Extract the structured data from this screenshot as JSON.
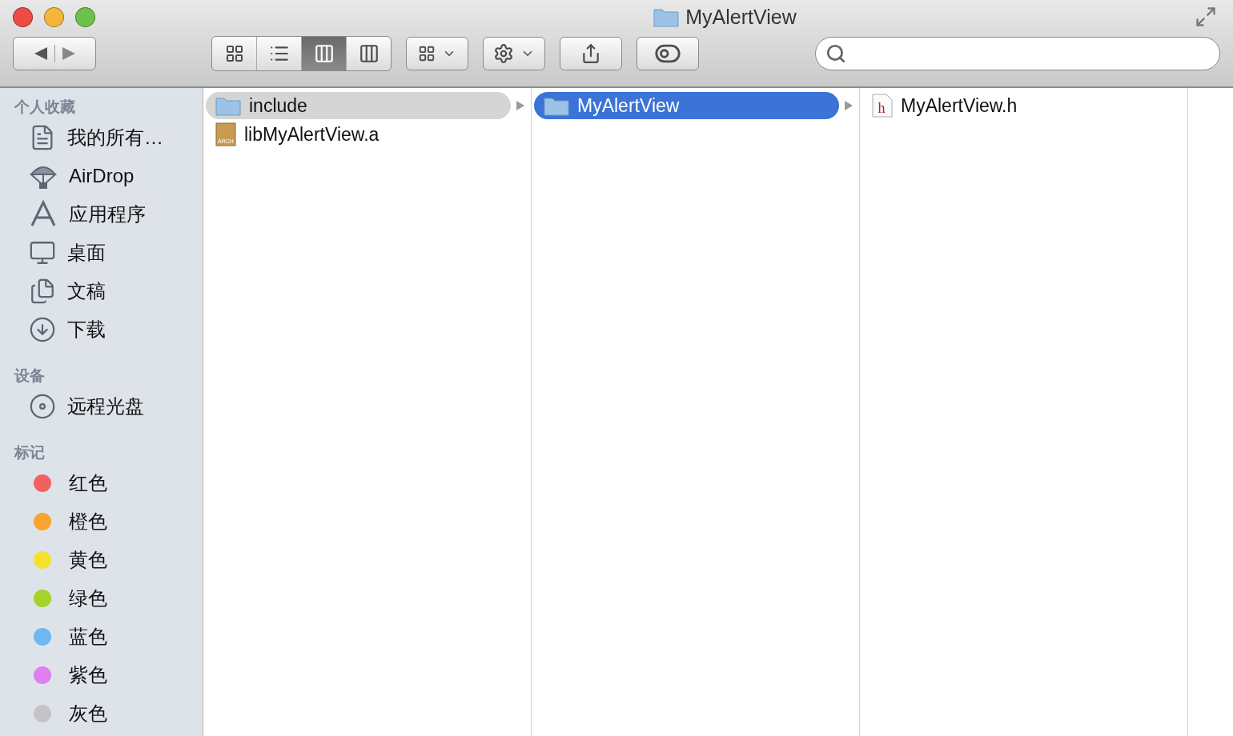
{
  "window": {
    "title": "MyAlertView"
  },
  "toolbar": {
    "view_modes": [
      {
        "kind": "icons",
        "selected": false
      },
      {
        "kind": "list",
        "selected": false
      },
      {
        "kind": "columns",
        "selected": true
      },
      {
        "kind": "coverflow",
        "selected": false
      }
    ]
  },
  "sidebar": {
    "sections": [
      {
        "kind": "places",
        "title": "个人收藏",
        "items": [
          {
            "label": "我的所有…"
          },
          {
            "label": "AirDrop"
          },
          {
            "label": "应用程序"
          },
          {
            "label": "桌面"
          },
          {
            "label": "文稿"
          },
          {
            "label": "下载"
          }
        ]
      },
      {
        "kind": "devices",
        "title": "设备",
        "items": [
          {
            "label": "远程光盘"
          }
        ]
      },
      {
        "kind": "tags",
        "title": "标记",
        "items": [
          {
            "label": "红色",
            "color": "#f0625e"
          },
          {
            "label": "橙色",
            "color": "#f9a42c"
          },
          {
            "label": "黄色",
            "color": "#f3e12e"
          },
          {
            "label": "绿色",
            "color": "#a5d32b"
          },
          {
            "label": "蓝色",
            "color": "#6fb8f2"
          },
          {
            "label": "紫色",
            "color": "#e07ff0"
          },
          {
            "label": "灰色",
            "color": "#c4c4c4"
          }
        ]
      }
    ]
  },
  "columns": [
    {
      "items": [
        {
          "name": "include",
          "kind": "folder",
          "selected": true,
          "focused": false,
          "has_children": true
        },
        {
          "name": "libMyAlertView.a",
          "kind": "archive",
          "icon_label": "ARCH",
          "selected": false,
          "has_children": false
        }
      ]
    },
    {
      "items": [
        {
          "name": "MyAlertView",
          "kind": "folder",
          "selected": true,
          "focused": true,
          "has_children": true
        }
      ]
    },
    {
      "items": [
        {
          "name": "MyAlertView.h",
          "kind": "header",
          "icon_label": "h",
          "selected": false,
          "has_children": false
        }
      ]
    }
  ]
}
